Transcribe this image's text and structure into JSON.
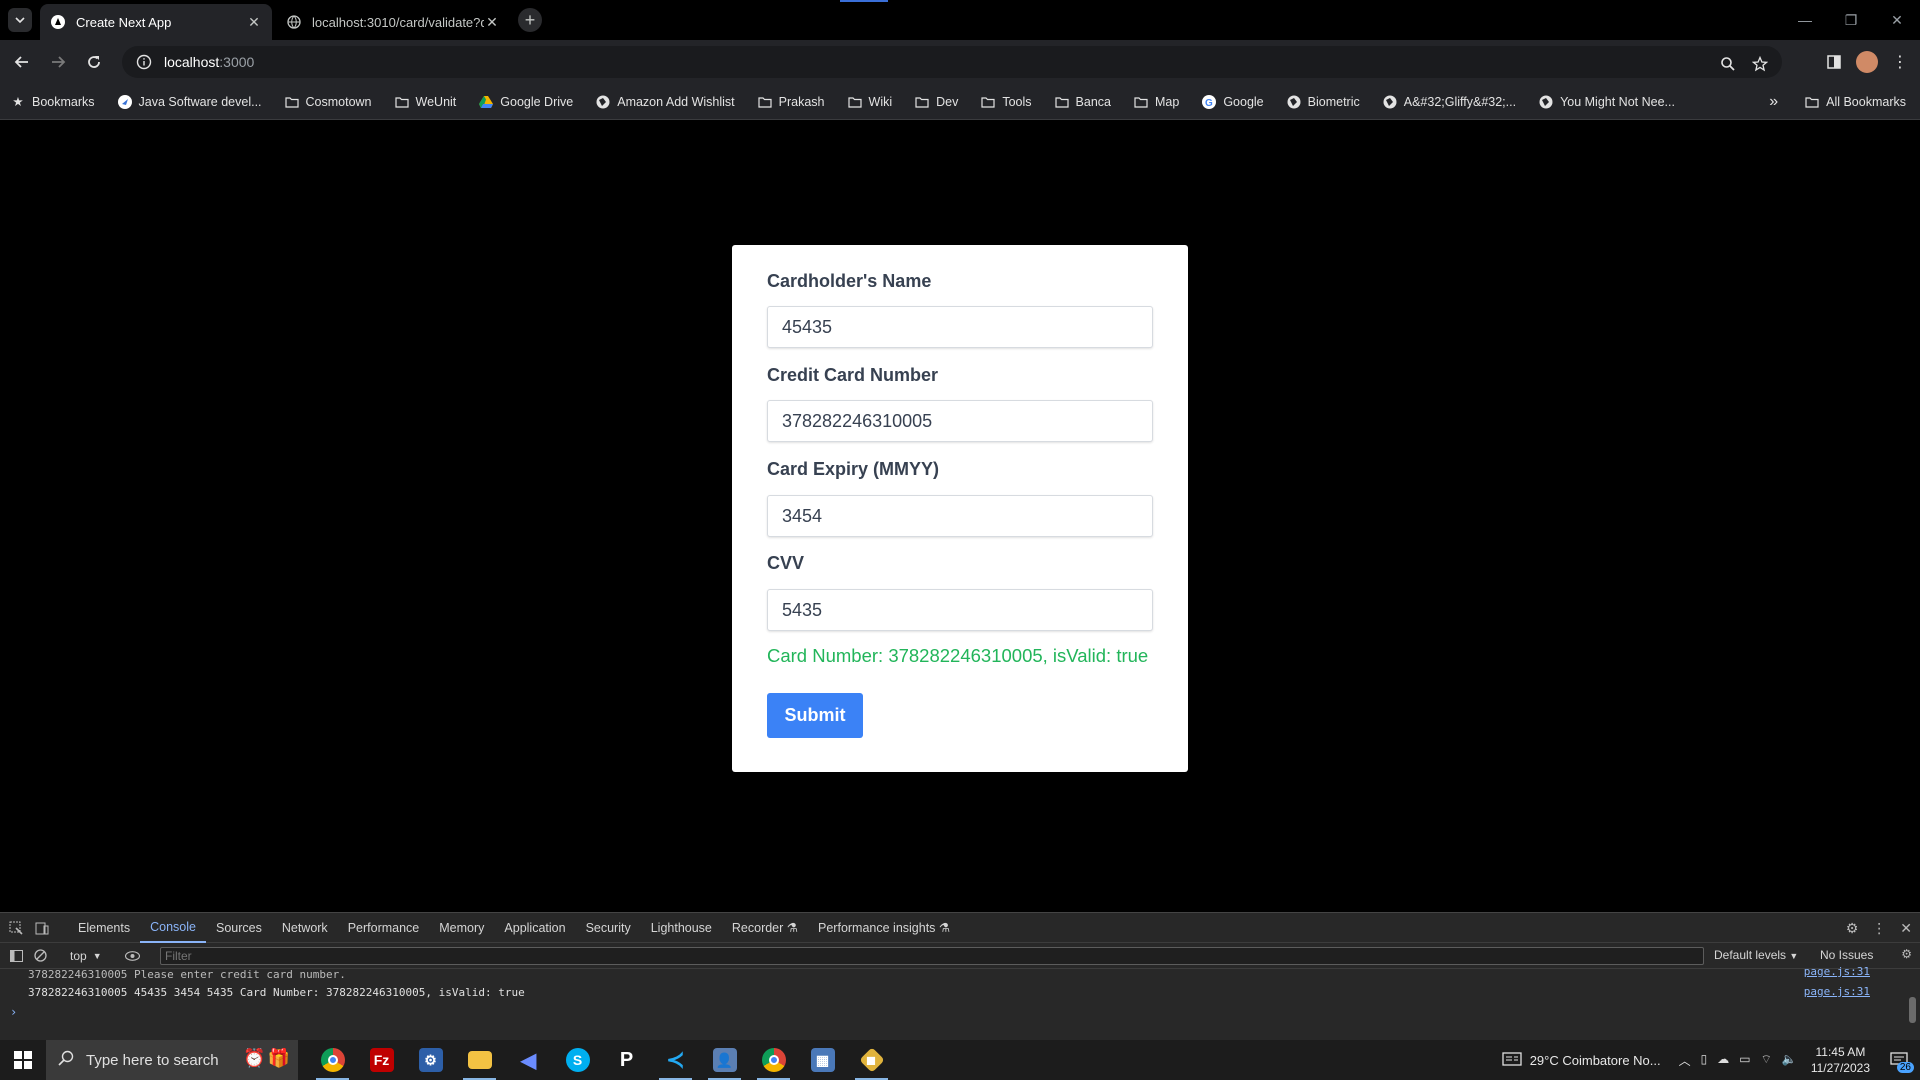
{
  "browser": {
    "tabs": [
      {
        "title": "Create Next App",
        "active": true
      },
      {
        "title": "localhost:3010/card/validate?d",
        "active": false
      }
    ],
    "url_host": "localhost",
    "url_port": ":3000"
  },
  "bookmarks": {
    "items": [
      {
        "label": "Bookmarks",
        "icon": "star-icon"
      },
      {
        "label": "Java Software devel...",
        "icon": "site-icon"
      },
      {
        "label": "Cosmotown",
        "icon": "folder-icon"
      },
      {
        "label": "WeUnit",
        "icon": "folder-icon"
      },
      {
        "label": "Google Drive",
        "icon": "drive-icon"
      },
      {
        "label": "Amazon Add Wishlist",
        "icon": "globe-icon"
      },
      {
        "label": "Prakash",
        "icon": "folder-icon"
      },
      {
        "label": "Wiki",
        "icon": "folder-icon"
      },
      {
        "label": "Dev",
        "icon": "folder-icon"
      },
      {
        "label": "Tools",
        "icon": "folder-icon"
      },
      {
        "label": "Banca",
        "icon": "folder-icon"
      },
      {
        "label": "Map",
        "icon": "folder-icon"
      },
      {
        "label": "Google",
        "icon": "google-icon"
      },
      {
        "label": "Biometric",
        "icon": "globe-icon"
      },
      {
        "label": "A&#32;Gliffy&#32;...",
        "icon": "globe-icon"
      },
      {
        "label": "You Might Not Nee...",
        "icon": "globe-icon"
      }
    ],
    "overflow": "»",
    "all_bookmarks": "All Bookmarks"
  },
  "form": {
    "name_label": "Cardholder's Name",
    "name_value": "45435",
    "number_label": "Credit Card Number",
    "number_value": "378282246310005",
    "expiry_label": "Card Expiry (MMYY)",
    "expiry_value": "3454",
    "cvv_label": "CVV",
    "cvv_value": "5435",
    "status": "Card Number: 378282246310005, isValid: true",
    "submit": "Submit",
    "status_color": "#22b55a",
    "button_color": "#3b82f6"
  },
  "devtools": {
    "tabs": [
      "Elements",
      "Console",
      "Sources",
      "Network",
      "Performance",
      "Memory",
      "Application",
      "Security",
      "Lighthouse",
      "Recorder",
      "Performance insights"
    ],
    "active_tab": "Console",
    "context": "top",
    "filter_placeholder": "Filter",
    "levels": "Default levels",
    "issues": "No Issues",
    "log_cut": "378282246310005   Please enter credit card number.",
    "log_cut_src": "page.js:31",
    "log_main": "378282246310005 45435 3454 5435 Card Number: 378282246310005, isValid: true",
    "log_main_src": "page.js:31"
  },
  "taskbar": {
    "search_placeholder": "Type here to search",
    "weather": "29°C  Coimbatore No...",
    "time": "11:45 AM",
    "date": "11/27/2023",
    "notifications": "26"
  }
}
